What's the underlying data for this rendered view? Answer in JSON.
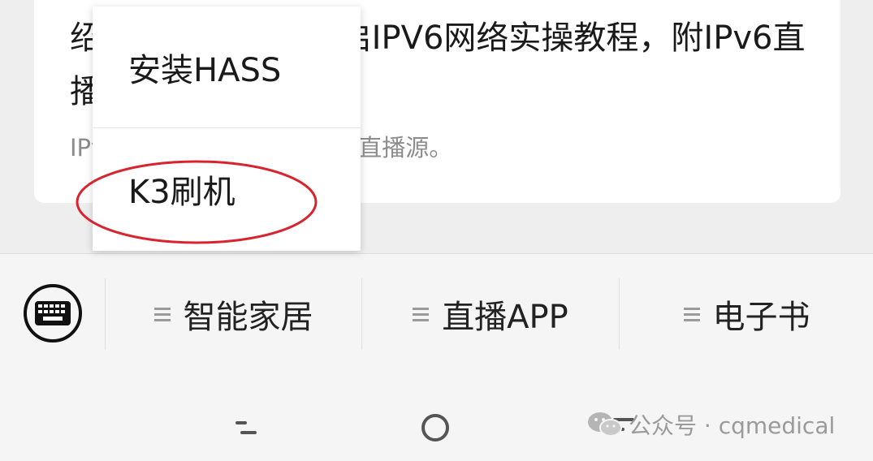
{
  "article": {
    "title": "绍如何在K3路由开启IPV6网络实操教程，附IPv6直播源",
    "description": "IPv6网络实操教程，附IPv6直播源。"
  },
  "popup_menu": {
    "items": [
      {
        "label": "安装HASS"
      },
      {
        "label": "K3刷机"
      }
    ],
    "highlight_color": "#d9232e"
  },
  "menubar": {
    "keyboard_icon": "keyboard-icon",
    "items": [
      {
        "label": "智能家居",
        "icon": "hamburger-icon"
      },
      {
        "label": "直播APP",
        "icon": "hamburger-icon"
      },
      {
        "label": "电子书",
        "icon": "hamburger-icon"
      }
    ]
  },
  "navbar": {
    "back_icon": "back-icon",
    "home_icon": "home-icon",
    "recent_icon": "recent-apps-icon"
  },
  "watermark": {
    "text": "公众号 · cqmedical",
    "icon": "wechat-icon"
  }
}
